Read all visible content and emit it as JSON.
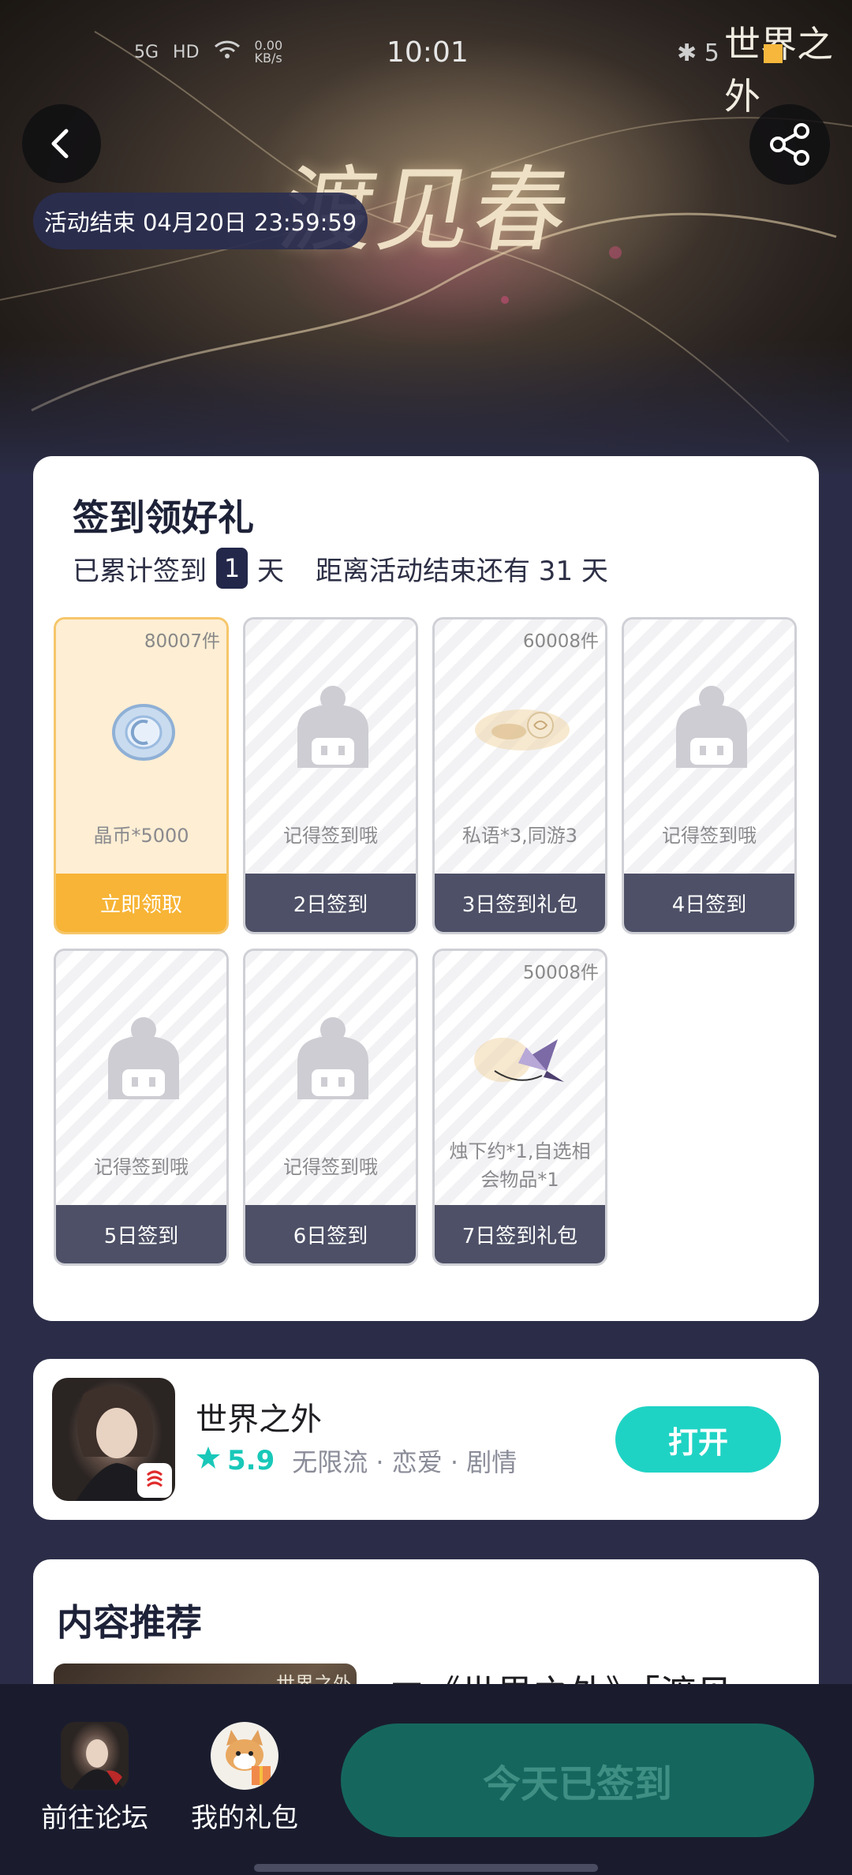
{
  "status_bar": {
    "left_text": "5G",
    "hd": "HD",
    "speed": "0.00 KB/s",
    "time": "10:01",
    "battery": "5"
  },
  "hero": {
    "logo_text": "世界之外",
    "title": "渡见春",
    "end_badge": "活动结束 04月20日 23:59:59"
  },
  "checkin": {
    "title": "签到领好礼",
    "accumulated_prefix": "已累计签到",
    "accumulated_days": "1",
    "accumulated_suffix": "天",
    "remaining": "距离活动结束还有 31 天",
    "tiles": [
      {
        "count": "80007件",
        "label": "晶币*5000",
        "foot": "立即领取",
        "state": "claimable"
      },
      {
        "count": "",
        "label": "记得签到哦",
        "foot": "2日签到",
        "state": "locked"
      },
      {
        "count": "60008件",
        "label": "私语*3,同游3",
        "foot": "3日签到礼包",
        "state": "gift"
      },
      {
        "count": "",
        "label": "记得签到哦",
        "foot": "4日签到",
        "state": "locked"
      },
      {
        "count": "",
        "label": "记得签到哦",
        "foot": "5日签到",
        "state": "locked"
      },
      {
        "count": "",
        "label": "记得签到哦",
        "foot": "6日签到",
        "state": "locked"
      },
      {
        "count": "50008件",
        "label": "烛下约*1,自选相会物品*1",
        "foot": "7日签到礼包",
        "state": "gift"
      }
    ]
  },
  "app": {
    "name": "世界之外",
    "rating": "5.9",
    "tags": "无限流 · 恋爱 · 剧情",
    "open_label": "打开"
  },
  "recommend": {
    "title": "内容推荐",
    "thumb_logo": "世界之外",
    "headline": "■《世界之外》「渡见"
  },
  "bottom_bar": {
    "forum_label": "前往论坛",
    "gift_label": "我的礼包",
    "signed_label": "今天已签到"
  },
  "colors": {
    "accent_teal": "#1fd3c4",
    "claim_orange": "#f7b436",
    "navy": "#23284a"
  }
}
